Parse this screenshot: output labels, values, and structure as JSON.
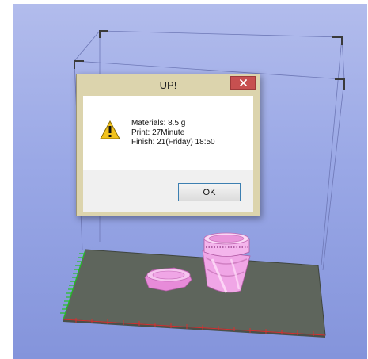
{
  "dialog": {
    "title": "UP!",
    "close_glyph": "×",
    "icon": "warning-icon",
    "messages": [
      "Materials: 8.5 g",
      "Print: 27Minute",
      "Finish: 21(Friday) 18:50"
    ],
    "ok_label": "OK"
  },
  "colors": {
    "viewport_top": "#b2bcec",
    "viewport_bottom": "#8494db",
    "platform": "#5e655c",
    "model": "#f0a6e6",
    "close_button": "#c75050",
    "y_axis": "#22c322",
    "x_axis": "#d43131"
  }
}
